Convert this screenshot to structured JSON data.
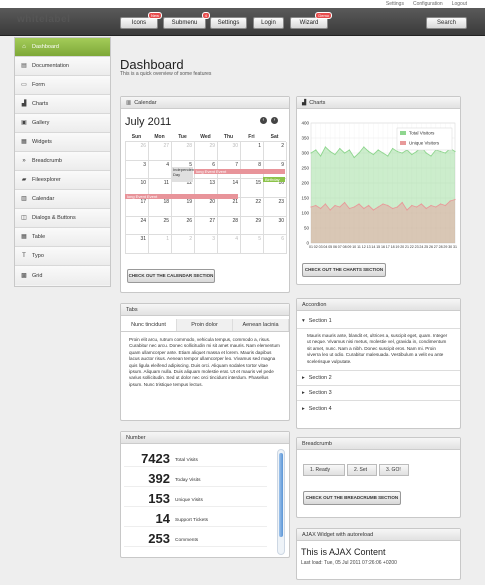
{
  "topbar": {
    "links": [
      "Settings",
      "Configuration",
      "Logout"
    ]
  },
  "header": {
    "logo": "whitelabel",
    "nav": [
      {
        "label": "Icons",
        "badge": "New"
      },
      {
        "label": "Submenu",
        "badge": "4"
      },
      {
        "label": "Settings",
        "badge": ""
      },
      {
        "label": "Login",
        "badge": ""
      },
      {
        "label": "Wizard",
        "badge": "Demo"
      }
    ],
    "search_label": "Search"
  },
  "sidebar": {
    "items": [
      {
        "label": "Dashboard",
        "icon": "home-icon"
      },
      {
        "label": "Documentation",
        "icon": "document-icon"
      },
      {
        "label": "Form",
        "icon": "form-icon"
      },
      {
        "label": "Charts",
        "icon": "chart-icon"
      },
      {
        "label": "Gallery",
        "icon": "gallery-icon"
      },
      {
        "label": "Widgets",
        "icon": "widgets-icon"
      },
      {
        "label": "Breadcrumb",
        "icon": "breadcrumb-icon"
      },
      {
        "label": "Fileexplorer",
        "icon": "folder-icon"
      },
      {
        "label": "Calendar",
        "icon": "calendar-icon"
      },
      {
        "label": "Dialogs & Buttons",
        "icon": "dialog-icon"
      },
      {
        "label": "Table",
        "icon": "table-icon"
      },
      {
        "label": "Typo",
        "icon": "typo-icon"
      },
      {
        "label": "Grid",
        "icon": "grid-icon"
      }
    ]
  },
  "page": {
    "title": "Dashboard",
    "subtitle": "This is a quick overview of some features"
  },
  "calendar": {
    "title": "Calendar",
    "month": "July 2011",
    "weekdays": [
      "Sun",
      "Mon",
      "Tue",
      "Wed",
      "Thu",
      "Fri",
      "Sat"
    ],
    "weeks": [
      [
        "26",
        "27",
        "28",
        "29",
        "30",
        "1",
        "2"
      ],
      [
        "3",
        "4",
        "5",
        "6",
        "7",
        "8",
        "9"
      ],
      [
        "10",
        "11",
        "12",
        "13",
        "14",
        "15",
        "16"
      ],
      [
        "17",
        "18",
        "19",
        "20",
        "21",
        "22",
        "23"
      ],
      [
        "24",
        "25",
        "26",
        "27",
        "28",
        "29",
        "30"
      ],
      [
        "31",
        "1",
        "2",
        "3",
        "4",
        "5",
        "6"
      ]
    ],
    "events": [
      {
        "label": "Independence Day",
        "color": "#e0e0e0"
      },
      {
        "label": "long Event Event",
        "color": "#e8949a"
      },
      {
        "label": "Birthday",
        "color": "#8cc34a"
      },
      {
        "label": "long Event Event",
        "color": "#e8949a"
      }
    ],
    "button": "CHECK OUT THE CALENDAR SECTION"
  },
  "charts": {
    "title": "Charts",
    "button": "CHECK OUT THE CHARTS SECTION"
  },
  "chart_data": {
    "type": "area",
    "ylim": [
      0,
      400
    ],
    "yticks": [
      0,
      50,
      100,
      150,
      200,
      250,
      300,
      350,
      400
    ],
    "x": [
      "01",
      "02",
      "03",
      "04",
      "05",
      "06",
      "07",
      "08",
      "09",
      "10",
      "11",
      "12",
      "13",
      "14",
      "15",
      "16",
      "17",
      "18",
      "19",
      "20",
      "21",
      "22",
      "23",
      "24",
      "25",
      "26",
      "27",
      "28",
      "29",
      "30",
      "31"
    ],
    "legend": "top-right",
    "series": [
      {
        "name": "Total Visitors",
        "color": "#8fd68f",
        "values": [
          300,
          310,
          290,
          320,
          305,
          295,
          315,
          300,
          310,
          285,
          300,
          320,
          305,
          295,
          310,
          300,
          290,
          315,
          305,
          300,
          310,
          295,
          305,
          320,
          300,
          290,
          310,
          305,
          300,
          315,
          305
        ]
      },
      {
        "name": "Unique Visitors",
        "color": "#e89a9a",
        "values": [
          120,
          125,
          115,
          130,
          110,
          125,
          120,
          135,
          115,
          120,
          130,
          115,
          125,
          110,
          120,
          130,
          125,
          115,
          120,
          135,
          110,
          125,
          120,
          130,
          115,
          125,
          120,
          130,
          125,
          140,
          145
        ]
      }
    ]
  },
  "tabs": {
    "title": "Tabs",
    "items": [
      "Nunc tincidunt",
      "Proin dolor",
      "Aenean lacinia"
    ],
    "content": "Proin elit arcu, rutrum commodo, vehicula tempus, commodo a, risus. Curabitur nec arcu. Donec sollicitudin mi sit amet mauris. Nam elementum quam ullamcorper ante. Etiam aliquet massa et lorem. Mauris dapibus lacus auctor risus. Aenean tempor ullamcorper leo. Vivamus sed magna quis ligula eleifend adipiscing. Duis orci. Aliquam sodales tortor vitae ipsum. Aliquam nulla. Duis aliquam molestie erat. Ut et mauris vel pede varius sollicitudin. Sed ut dolor nec orci tincidunt interdum. Phasellus ipsum. Nunc tristique tempus lectus."
  },
  "numbers": {
    "title": "Number",
    "rows": [
      {
        "value": "7423",
        "label": "Total Visits"
      },
      {
        "value": "392",
        "label": "Today Visits"
      },
      {
        "value": "153",
        "label": "Unique Visits"
      },
      {
        "value": "14",
        "label": "Support Tickets"
      },
      {
        "value": "253",
        "label": "Comments"
      }
    ]
  },
  "accordion": {
    "title": "Accordion",
    "sections": [
      "Section 1",
      "Section 2",
      "Section 3",
      "Section 4"
    ],
    "content": "Mauris mauris ante, blandit et, ultrices a, suscipit eget, quam. Integer ut neque. Vivamus nisi metus, molestie vel, gravida in, condimentum sit amet, nunc. Nam a nibh. Donec suscipit eros. Nam mi. Proin viverra leo ut odio. Curabitur malesuada. Vestibulum a velit eu ante scelerisque vulputate."
  },
  "breadcrumb": {
    "title": "Breadcrumb",
    "steps": [
      "1. Ready",
      "2. Set",
      "3. GO!"
    ],
    "button": "CHECK OUT THE BREADCRUMB SECTION"
  },
  "ajax": {
    "title": "AJAX Widget with autoreload",
    "heading": "This is AJAX Content",
    "last_load": "Last load: Tue, 05 Jul 2011 07:26:06 +0200"
  }
}
